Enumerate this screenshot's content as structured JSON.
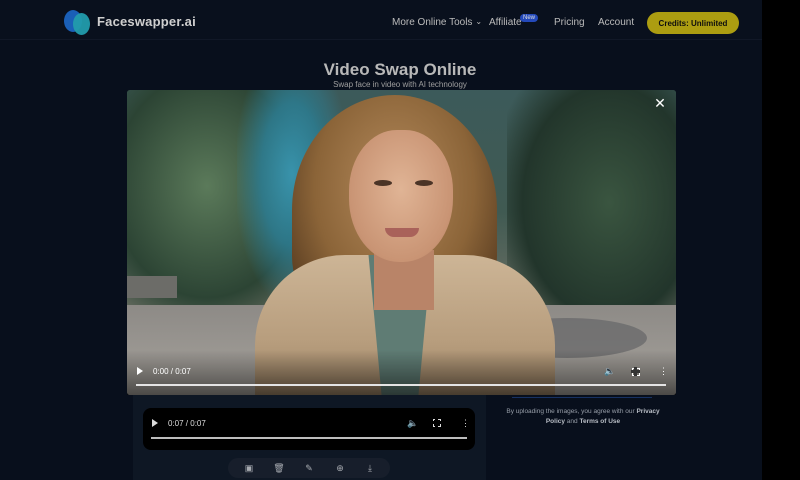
{
  "header": {
    "brand": "Faceswapper.ai",
    "nav": {
      "more_tools": "More Online Tools",
      "affiliate": "Affiliate",
      "affiliate_badge": "New",
      "pricing": "Pricing",
      "account": "Account"
    },
    "credits_button": "Credits: Unlimited"
  },
  "hero": {
    "title": "Video Swap Online",
    "subtitle": "Swap face in video with AI technology"
  },
  "modal_video": {
    "time": "0:00 / 0:07",
    "progress": 0
  },
  "result_video": {
    "time": "0:07 / 0:07",
    "progress": 1
  },
  "notice": {
    "prefix": "By uploading the images, you agree with our",
    "privacy": "Privacy Policy",
    "and": "and",
    "terms": "Terms of Use"
  },
  "icons": {
    "close": "close-icon",
    "tools": [
      "image-icon",
      "trash-icon",
      "pencil-icon",
      "zoom-in-icon",
      "download-icon"
    ]
  },
  "colors": {
    "accent_yellow": "#c9b714",
    "badge_blue": "#2a56d9",
    "background": "#0a1221"
  }
}
